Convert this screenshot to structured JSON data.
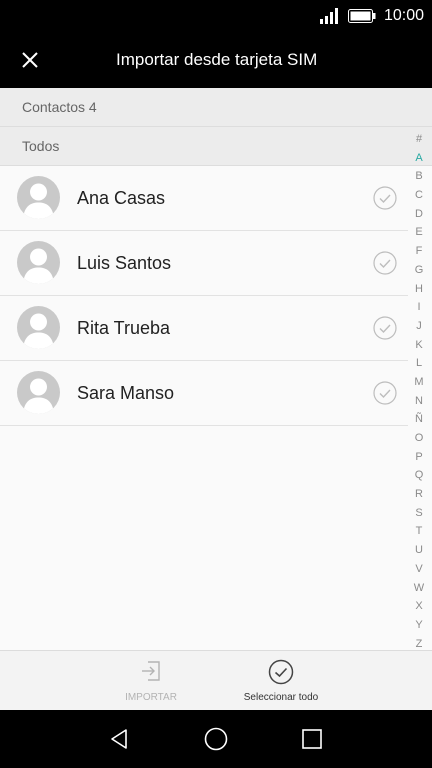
{
  "status_bar": {
    "time": "10:00"
  },
  "app_bar": {
    "title": "Importar desde tarjeta SIM"
  },
  "sections": {
    "count_label": "Contactos 4",
    "group_label": "Todos"
  },
  "contacts": [
    {
      "name": "Ana Casas"
    },
    {
      "name": "Luis Santos"
    },
    {
      "name": "Rita Trueba"
    },
    {
      "name": "Sara Manso"
    }
  ],
  "alphabet_index": [
    "#",
    "A",
    "B",
    "C",
    "D",
    "E",
    "F",
    "G",
    "H",
    "I",
    "J",
    "K",
    "L",
    "M",
    "N",
    "Ñ",
    "O",
    "P",
    "Q",
    "R",
    "S",
    "T",
    "U",
    "V",
    "W",
    "X",
    "Y",
    "Z"
  ],
  "alphabet_active": "A",
  "bottom_actions": {
    "import_label": "IMPORTAR",
    "select_all_label": "Seleccionar todo"
  },
  "colors": {
    "accent": "#27a9a2",
    "bar": "#000000",
    "disabled": "#b3b3b3"
  },
  "icons": {
    "close": "close-icon",
    "back": "back-triangle-icon",
    "home": "home-circle-icon",
    "recents": "recents-square-icon"
  }
}
